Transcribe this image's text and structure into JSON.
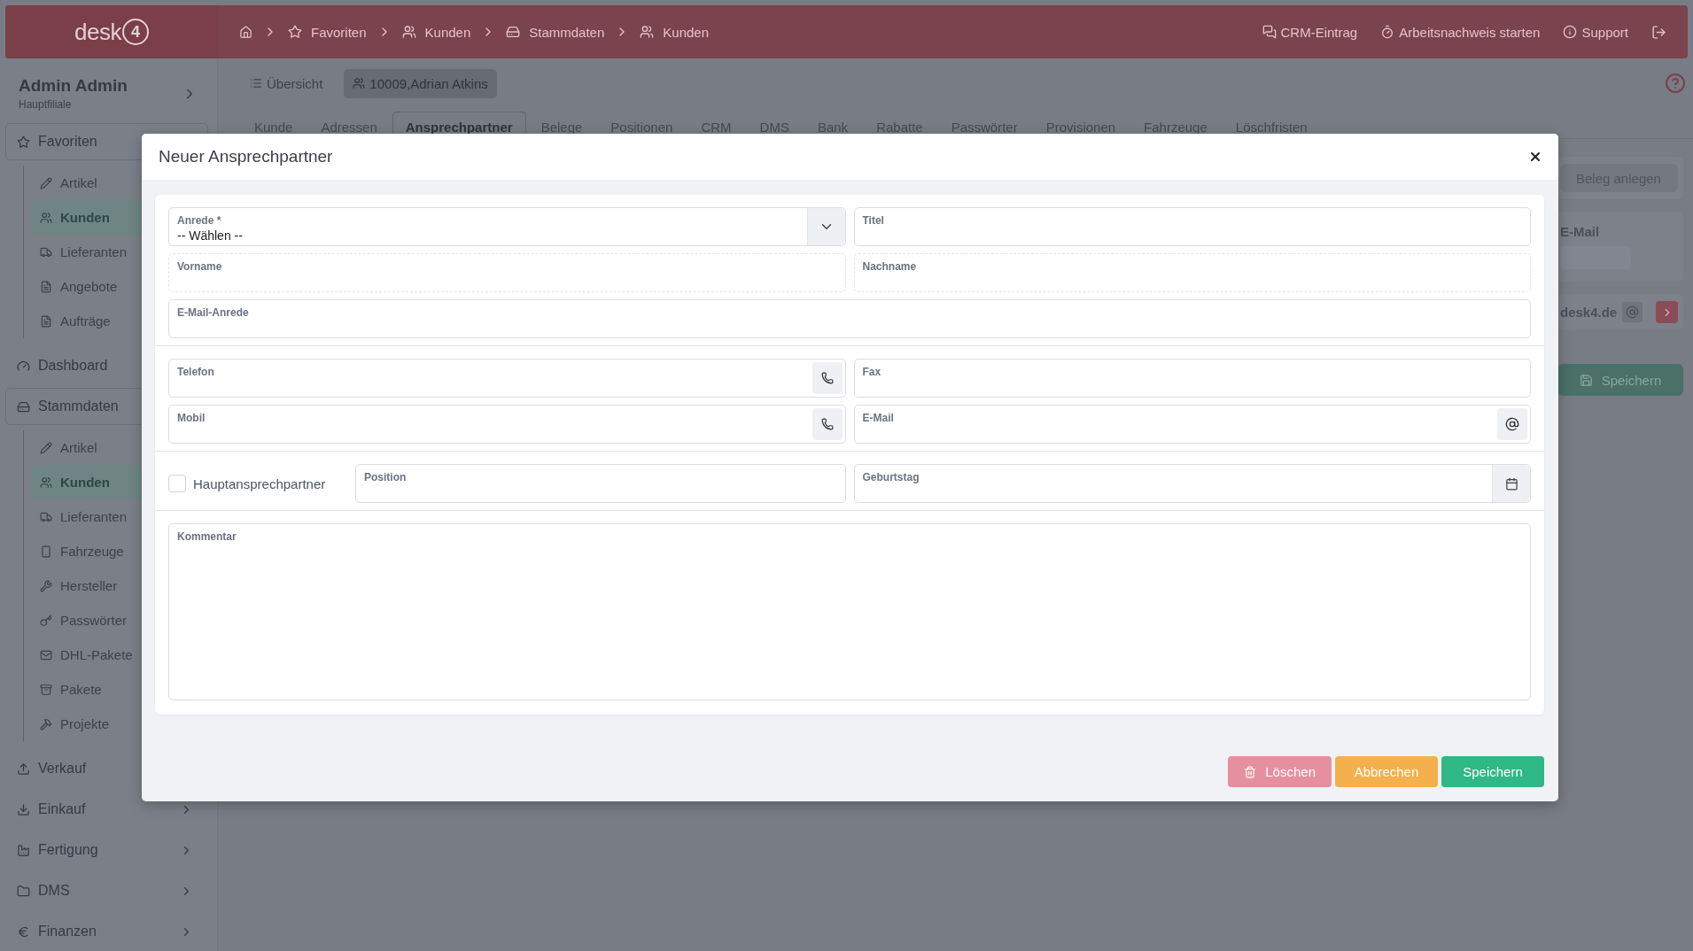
{
  "top_bar": {
    "logo": {
      "text": "desk",
      "badge": "4"
    },
    "breadcrumbs": [
      "Favoriten",
      "Kunden",
      "Stammdaten",
      "Kunden"
    ],
    "actions": [
      "CRM-Eintrag",
      "Arbeitsnachweis starten",
      "Support"
    ]
  },
  "sidebar": {
    "user": "Admin Admin",
    "branch": "Hauptfiliale",
    "groups": [
      {
        "label": "Favoriten",
        "expanded": true,
        "children": [
          {
            "label": "Artikel",
            "selected": false
          },
          {
            "label": "Kunden",
            "selected": true
          },
          {
            "label": "Lieferanten",
            "selected": false
          },
          {
            "label": "Angebote",
            "selected": false
          },
          {
            "label": "Aufträge",
            "selected": false
          }
        ]
      },
      {
        "label": "Dashboard",
        "expanded": false
      },
      {
        "label": "Stammdaten",
        "expanded": true,
        "children": [
          {
            "label": "Artikel",
            "selected": false
          },
          {
            "label": "Kunden",
            "selected": true
          },
          {
            "label": "Lieferanten",
            "selected": false
          },
          {
            "label": "Fahrzeuge",
            "selected": false
          },
          {
            "label": "Hersteller",
            "selected": false
          },
          {
            "label": "Passwörter",
            "selected": false
          },
          {
            "label": "DHL-Pakete",
            "selected": false
          },
          {
            "label": "Pakete",
            "selected": false
          },
          {
            "label": "Projekte",
            "selected": false
          }
        ]
      },
      {
        "label": "Verkauf",
        "expanded": false
      },
      {
        "label": "Einkauf",
        "expanded": false
      },
      {
        "label": "Fertigung",
        "expanded": false
      },
      {
        "label": "DMS",
        "expanded": false
      },
      {
        "label": "Finanzen",
        "expanded": false
      }
    ]
  },
  "subnav": [
    {
      "label": "Übersicht",
      "selected": false
    },
    {
      "label": "10009,Adrian Atkins",
      "selected": true
    }
  ],
  "tabs": [
    {
      "label": "Kunde",
      "selected": false
    },
    {
      "label": "Adressen",
      "selected": false
    },
    {
      "label": "Ansprechpartner",
      "selected": true
    },
    {
      "label": "Belege",
      "selected": false
    },
    {
      "label": "Positionen",
      "selected": false
    },
    {
      "label": "CRM",
      "selected": false
    },
    {
      "label": "DMS",
      "selected": false
    },
    {
      "label": "Bank",
      "selected": false
    },
    {
      "label": "Rabatte",
      "selected": false
    },
    {
      "label": "Passwörter",
      "selected": false
    },
    {
      "label": "Provisionen",
      "selected": false
    },
    {
      "label": "Fahrzeuge",
      "selected": false
    },
    {
      "label": "Löschfristen",
      "selected": false
    }
  ],
  "background_panel": {
    "create_button": "Beleg anlegen",
    "email_label": "E-Mail",
    "email_value": "desk4.de",
    "save_button": "Speichern"
  },
  "modal": {
    "title": "Neuer Ansprechpartner",
    "sections": [
      {
        "rows": [
          [
            {
              "kind": "select",
              "label": "Anrede *",
              "value": "-- Wählen --",
              "disabled": false
            },
            {
              "kind": "text",
              "label": "Titel",
              "disabled": false
            }
          ],
          [
            {
              "kind": "text",
              "label": "Vorname",
              "disabled": true
            },
            {
              "kind": "text",
              "label": "Nachname",
              "disabled": true
            }
          ],
          [
            {
              "kind": "text",
              "label": "E-Mail-Anrede",
              "disabled": false
            }
          ]
        ]
      },
      {
        "rows": [
          [
            {
              "kind": "phone",
              "label": "Telefon",
              "disabled": false
            },
            {
              "kind": "text",
              "label": "Fax",
              "disabled": false
            }
          ],
          [
            {
              "kind": "phone",
              "label": "Mobil",
              "disabled": false
            },
            {
              "kind": "email",
              "label": "E-Mail",
              "disabled": false
            }
          ]
        ]
      },
      {
        "rows": [
          [
            {
              "kind": "checkbox",
              "label": "Hauptansprechpartner",
              "checked": false
            },
            {
              "kind": "text",
              "label": "Position",
              "disabled": false
            },
            {
              "kind": "date",
              "label": "Geburtstag",
              "disabled": false
            }
          ]
        ]
      },
      {
        "rows": [
          [
            {
              "kind": "textarea",
              "label": "Kommentar",
              "disabled": false
            }
          ]
        ]
      }
    ],
    "buttons": [
      {
        "kind": "delete",
        "label": "Löschen"
      },
      {
        "kind": "cancel",
        "label": "Abbrechen"
      },
      {
        "kind": "save",
        "label": "Speichern"
      }
    ]
  }
}
